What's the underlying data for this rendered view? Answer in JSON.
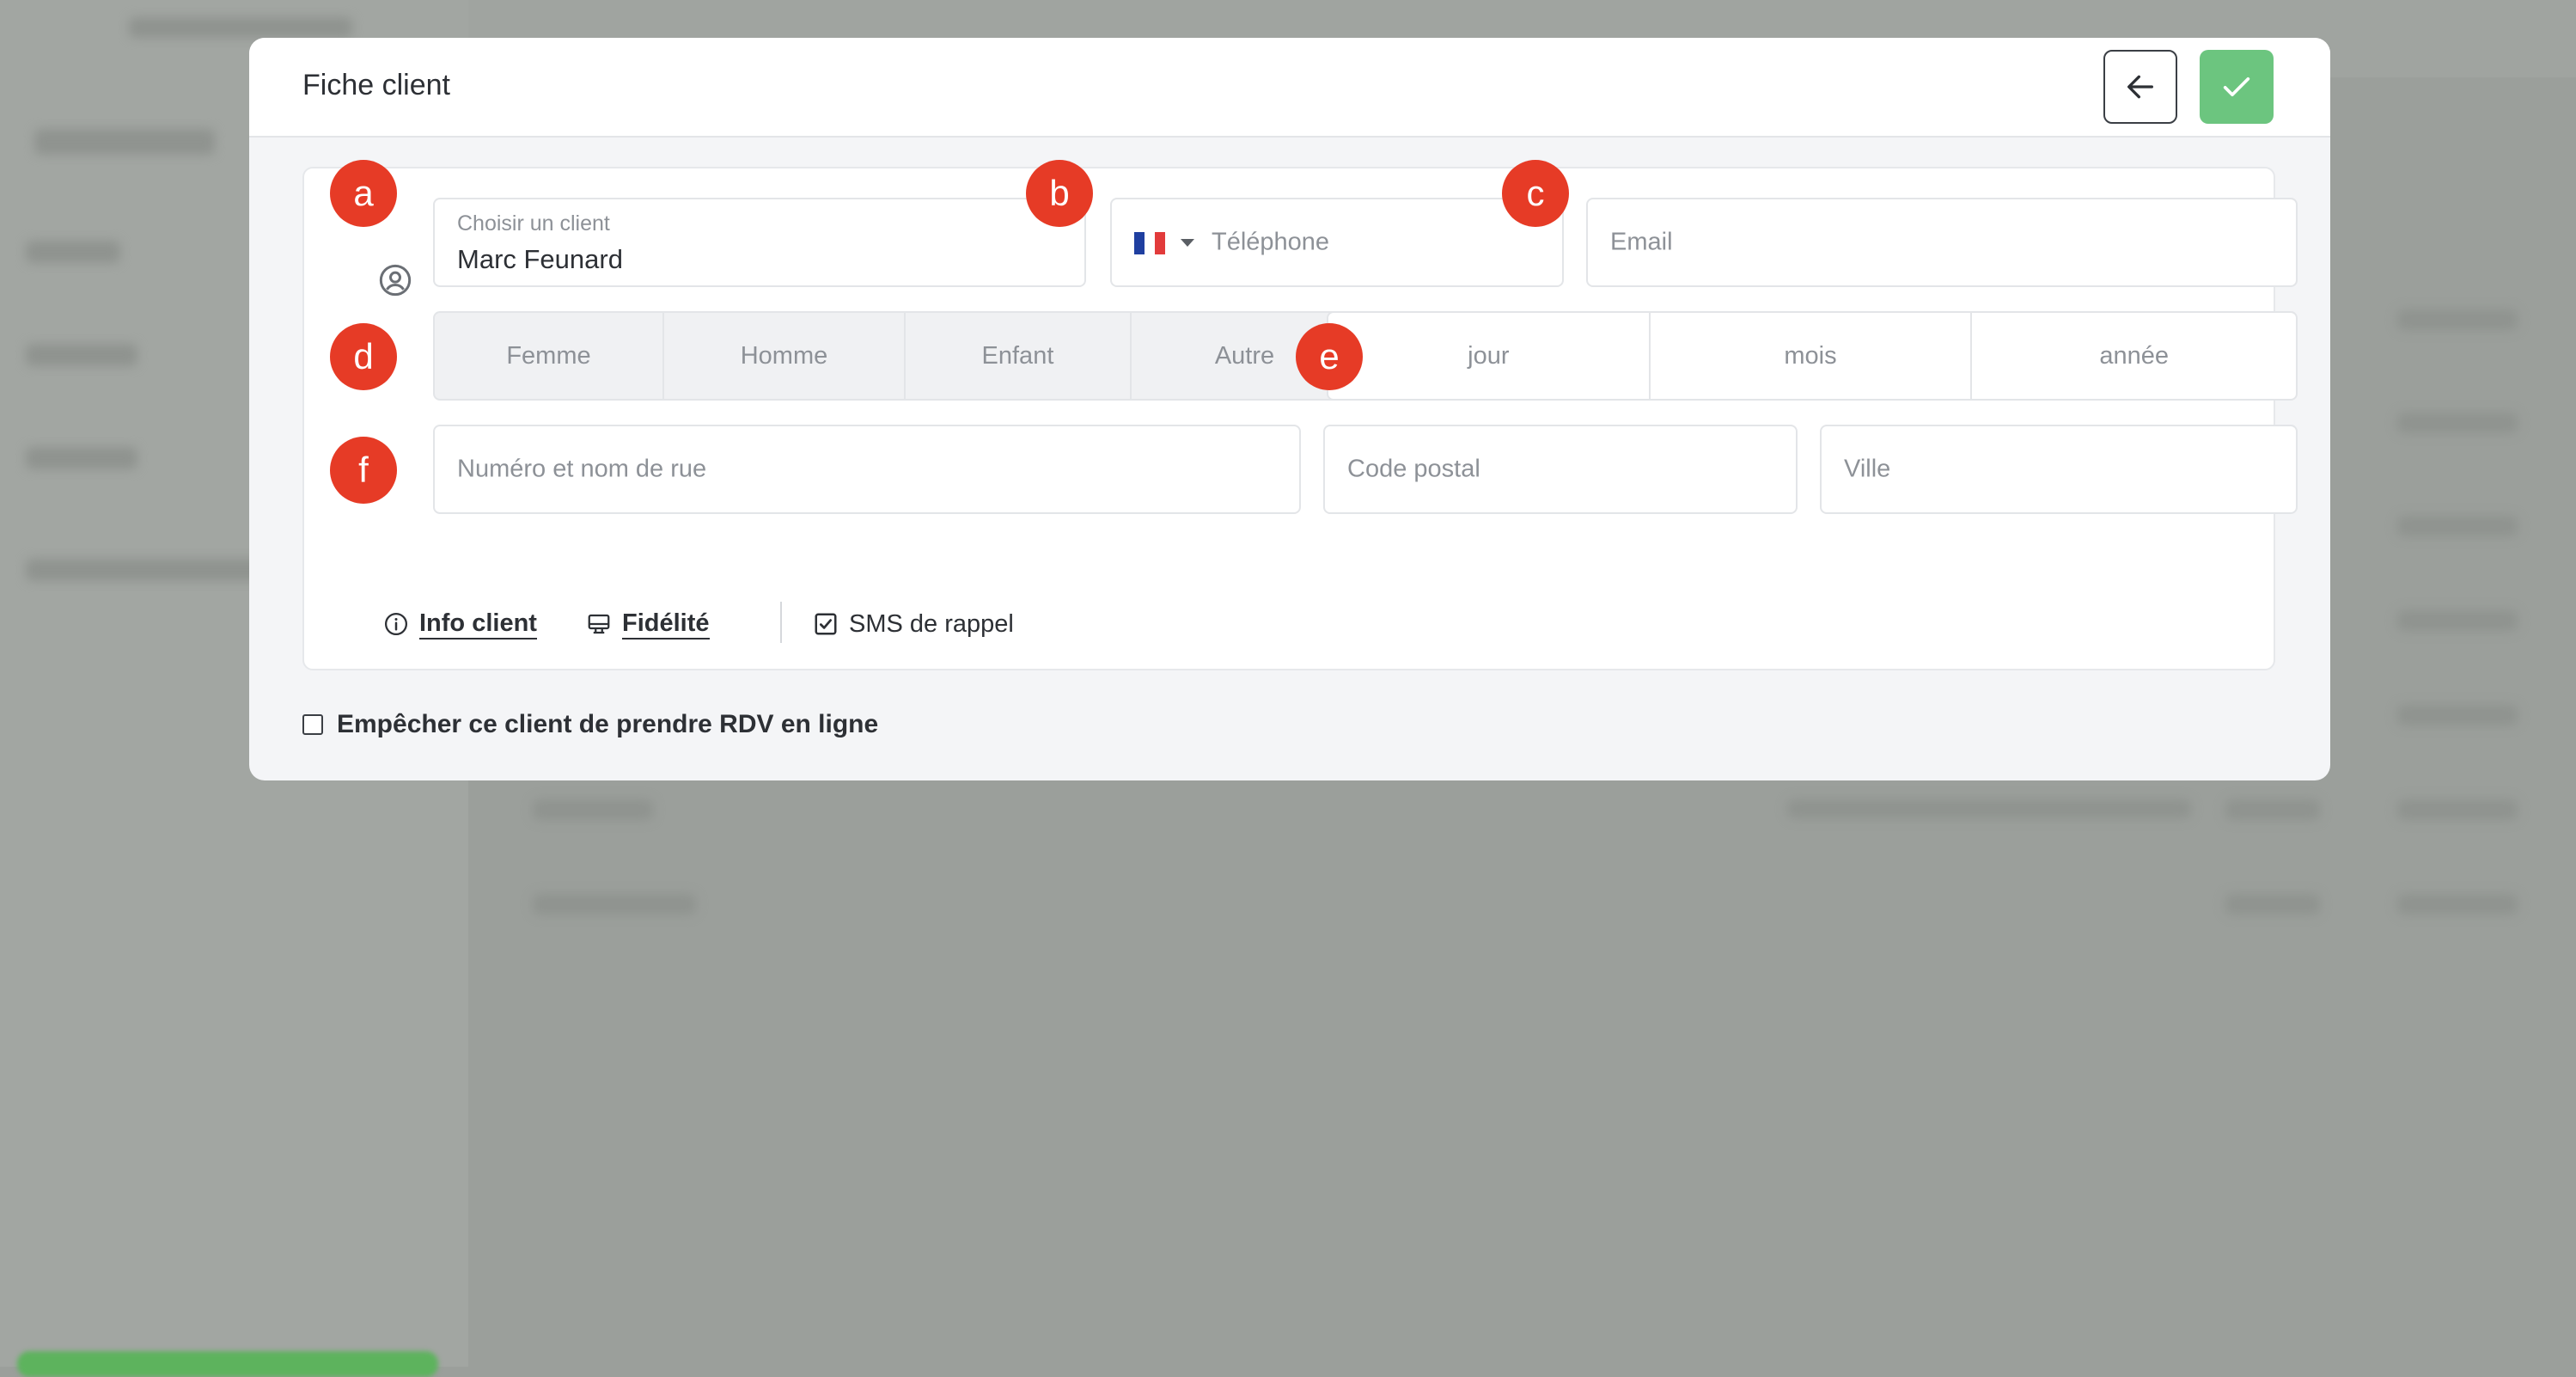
{
  "modal": {
    "title": "Fiche client",
    "back_icon": "arrow-left-icon",
    "confirm_icon": "check-icon"
  },
  "client": {
    "label": "Choisir un client",
    "value": "Marc Feunard",
    "icon": "user-circle-icon"
  },
  "phone": {
    "country_flag": "france-flag-icon",
    "placeholder": "Téléphone"
  },
  "email": {
    "placeholder": "Email"
  },
  "gender": {
    "options": [
      "Femme",
      "Homme",
      "Enfant",
      "Autre"
    ]
  },
  "birthdate": {
    "day": "jour",
    "month": "mois",
    "year": "année"
  },
  "address": {
    "street_placeholder": "Numéro et nom de rue",
    "zip_placeholder": "Code postal",
    "city_placeholder": "Ville"
  },
  "links": {
    "info": "Info client",
    "loyalty": "Fidélité",
    "sms": "SMS de rappel",
    "sms_checked": true
  },
  "block_online": {
    "label": "Empêcher ce client de prendre RDV en ligne",
    "checked": false
  },
  "annotations": [
    "a",
    "b",
    "c",
    "d",
    "e",
    "f"
  ],
  "colors": {
    "confirm": "#6cc57f",
    "badge": "#e63b26",
    "overlay": "#9b9f9b"
  }
}
